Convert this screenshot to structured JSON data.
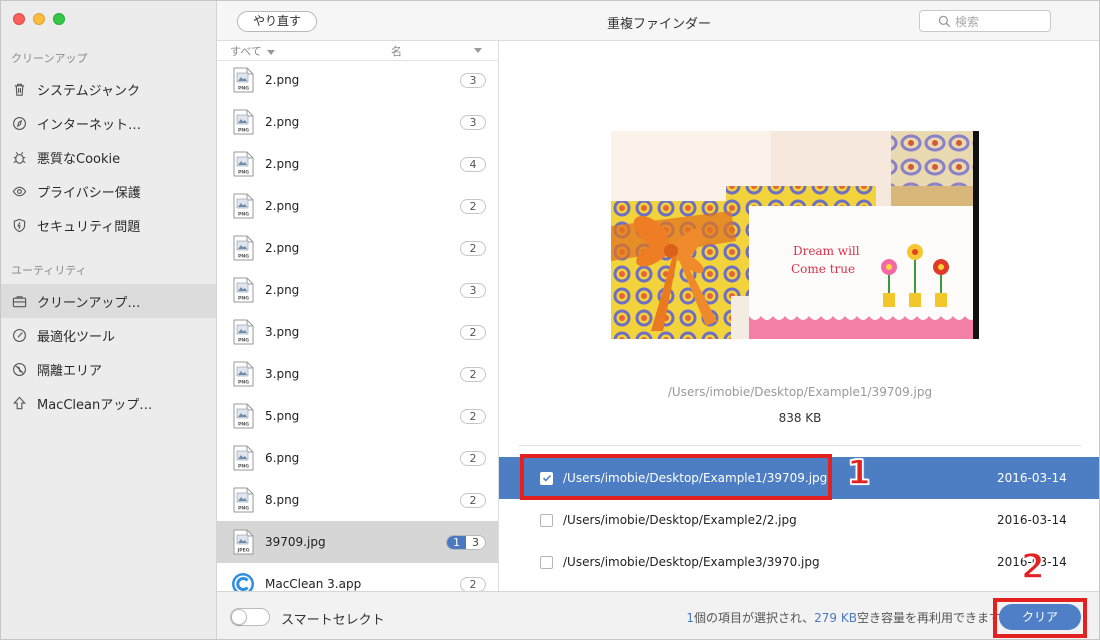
{
  "window": {
    "title": "重複ファインダー"
  },
  "toolbar": {
    "redo_label": "やり直す",
    "search_placeholder": "検索"
  },
  "sidebar": {
    "sections": [
      {
        "title": "クリーンアップ",
        "items": [
          {
            "label": "システムジャンク",
            "icon": "trash-icon"
          },
          {
            "label": "インターネット…",
            "icon": "compass-icon"
          },
          {
            "label": "悪質なCookie",
            "icon": "bug-icon"
          },
          {
            "label": "プライバシー保護",
            "icon": "eye-icon"
          },
          {
            "label": "セキュリティ問題",
            "icon": "shield-icon"
          }
        ]
      },
      {
        "title": "ユーティリティ",
        "items": [
          {
            "label": "クリーンアップ…",
            "icon": "briefcase-icon",
            "active": true
          },
          {
            "label": "最適化ツール",
            "icon": "gauge-icon"
          },
          {
            "label": "隔離エリア",
            "icon": "no-entry-icon"
          },
          {
            "label": "MacCleanアップ…",
            "icon": "upload-arrow-icon"
          }
        ]
      }
    ]
  },
  "file_list": {
    "header_all": "すべて",
    "header_name": "名",
    "rows": [
      {
        "name": "2.png",
        "count": "3",
        "type": "PNG"
      },
      {
        "name": "2.png",
        "count": "3",
        "type": "PNG"
      },
      {
        "name": "2.png",
        "count": "4",
        "type": "PNG"
      },
      {
        "name": "2.png",
        "count": "2",
        "type": "PNG"
      },
      {
        "name": "2.png",
        "count": "2",
        "type": "PNG"
      },
      {
        "name": "2.png",
        "count": "3",
        "type": "PNG"
      },
      {
        "name": "3.png",
        "count": "2",
        "type": "PNG"
      },
      {
        "name": "3.png",
        "count": "2",
        "type": "PNG"
      },
      {
        "name": "5.png",
        "count": "2",
        "type": "PNG"
      },
      {
        "name": "6.png",
        "count": "2",
        "type": "PNG"
      },
      {
        "name": "8.png",
        "count": "2",
        "type": "PNG"
      },
      {
        "name": "39709.jpg",
        "selected_count": "1",
        "count": "3",
        "type": "JPEG",
        "active": true
      },
      {
        "name": "MacClean 3.app",
        "count": "2",
        "type": "APP"
      }
    ]
  },
  "preview": {
    "image_text_line1": "Dream will",
    "image_text_line2": "Come true",
    "path": "/Users/imobie/Desktop/Example1/39709.jpg",
    "size": "838 KB"
  },
  "duplicates": [
    {
      "path": "/Users/imobie/Desktop/Example1/39709.jpg",
      "date": "2016-03-14",
      "checked": true
    },
    {
      "path": "/Users/imobie/Desktop/Example2/2.jpg",
      "date": "2016-03-14",
      "checked": false
    },
    {
      "path": "/Users/imobie/Desktop/Example3/3970.jpg",
      "date": "2016-03-14",
      "checked": false
    }
  ],
  "annotations": {
    "step1": "1",
    "step2": "2"
  },
  "bottom": {
    "smart_select_label": "スマートセレクト",
    "status_count": "1",
    "status_middle": "個の項目が選択され、",
    "status_size": "279 KB",
    "status_tail": "空き容量を再利用できます",
    "clear_label": "クリア"
  },
  "colors": {
    "accent": "#4a79c2",
    "selected_row": "#4d7ec4",
    "highlight": "#e32121"
  }
}
